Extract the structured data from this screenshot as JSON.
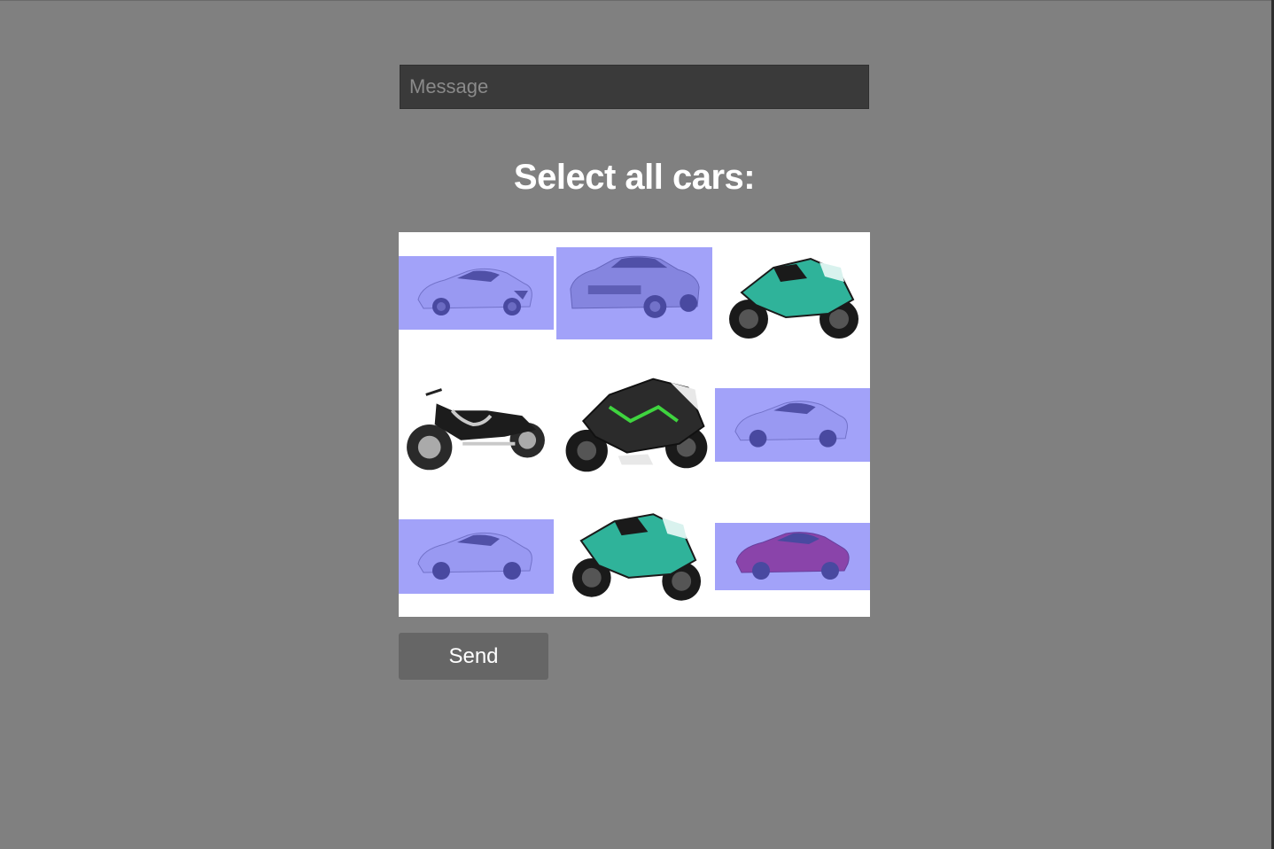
{
  "message": {
    "placeholder": "Message",
    "value": ""
  },
  "prompt": {
    "title": "Select all cars:"
  },
  "grid": {
    "tiles": [
      {
        "name": "tile-1",
        "subject": "white-sports-coupe",
        "kind": "car",
        "selected": true
      },
      {
        "name": "tile-2",
        "subject": "gray-muscle-sedan",
        "kind": "car",
        "selected": true
      },
      {
        "name": "tile-3",
        "subject": "teal-sport-motorcycle",
        "kind": "motorcycle",
        "selected": false
      },
      {
        "name": "tile-4",
        "subject": "cruiser-motorcycle",
        "kind": "motorcycle",
        "selected": false
      },
      {
        "name": "tile-5",
        "subject": "green-black-sport-motorcycle",
        "kind": "motorcycle",
        "selected": false
      },
      {
        "name": "tile-6",
        "subject": "white-sports-coupe",
        "kind": "car",
        "selected": true
      },
      {
        "name": "tile-7",
        "subject": "white-sports-coupe",
        "kind": "car",
        "selected": true
      },
      {
        "name": "tile-8",
        "subject": "teal-sport-motorcycle",
        "kind": "motorcycle",
        "selected": false
      },
      {
        "name": "tile-9",
        "subject": "red-sports-car",
        "kind": "car",
        "selected": true
      }
    ]
  },
  "actions": {
    "send_label": "Send"
  },
  "colors": {
    "background": "#808080",
    "input_bg": "#3a3a3a",
    "selection_overlay": "#6464f5",
    "button_bg": "#666666",
    "title_text": "#ffffff"
  }
}
